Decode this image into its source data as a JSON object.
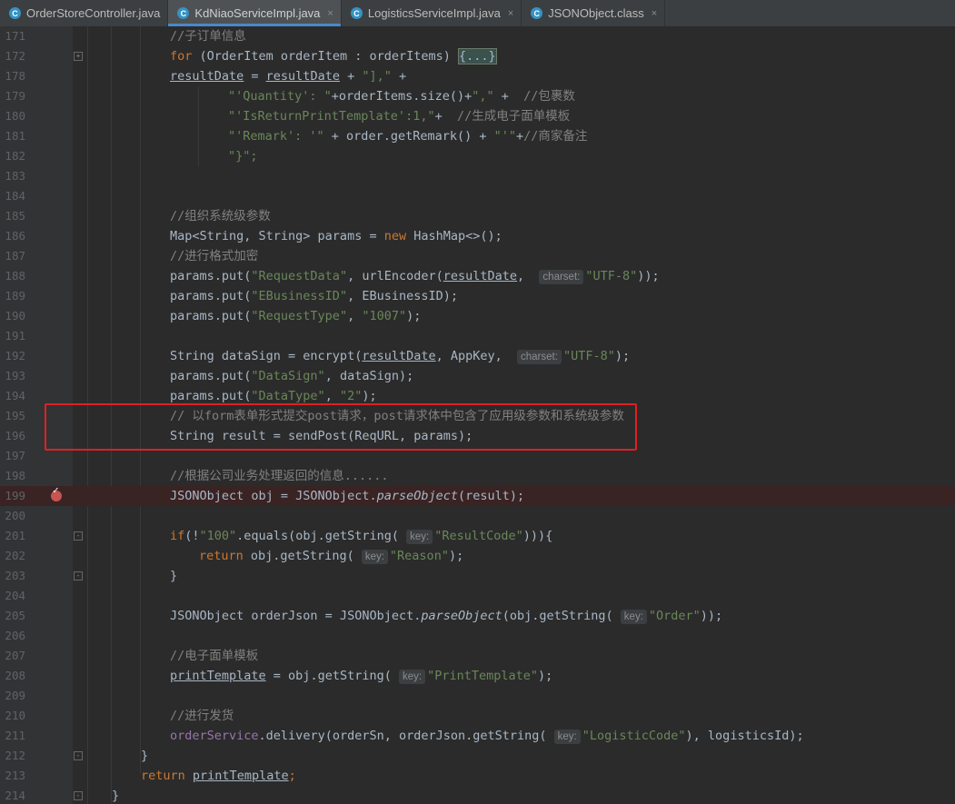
{
  "tabs": [
    {
      "label": "OrderStoreController.java",
      "active": false,
      "closable": false
    },
    {
      "label": "KdNiaoServiceImpl.java",
      "active": true,
      "closable": true
    },
    {
      "label": "LogisticsServiceImpl.java",
      "active": false,
      "closable": true
    },
    {
      "label": "JSONObject.class",
      "active": false,
      "closable": true
    }
  ],
  "tab_icon_letter": "C",
  "close_glyph": "×",
  "fold_collapsed_text": "{...}",
  "hints": {
    "charset": "charset:",
    "key": "key:"
  },
  "lines": {
    "171": "171",
    "172": "172",
    "178": "178",
    "179": "179",
    "180": "180",
    "181": "181",
    "182": "182",
    "183": "183",
    "184": "184",
    "185": "185",
    "186": "186",
    "187": "187",
    "188": "188",
    "189": "189",
    "190": "190",
    "191": "191",
    "192": "192",
    "193": "193",
    "194": "194",
    "195": "195",
    "196": "196",
    "197": "197",
    "198": "198",
    "199": "199",
    "200": "200",
    "201": "201",
    "202": "202",
    "203": "203",
    "204": "204",
    "205": "205",
    "206": "206",
    "207": "207",
    "208": "208",
    "209": "209",
    "210": "210",
    "211": "211",
    "212": "212",
    "213": "213",
    "214": "214"
  },
  "code": {
    "c171": "//子订单信息",
    "c172_a": "for",
    "c172_b": " (OrderItem orderItem : orderItems) ",
    "c178_a": "resultDate",
    "c178_b": " = ",
    "c178_c": "resultDate",
    "c178_d": " + ",
    "c178_e": "\"],\"",
    "c178_f": " +",
    "c179_a": "\"'Quantity': \"",
    "c179_b": "+orderItems.size()+",
    "c179_c": "\",\"",
    "c179_d": " +  ",
    "c179_e": "//包裹数",
    "c180_a": "\"'IsReturnPrintTemplate':1,\"",
    "c180_b": "+  ",
    "c180_c": "//生成电子面单模板",
    "c181_a": "\"'Remark': '\"",
    "c181_b": " + order.getRemark() + ",
    "c181_c": "\"'\"",
    "c181_d": "+",
    "c181_e": "//商家备注",
    "c182": "\"}\";",
    "c185": "//组织系统级参数",
    "c186_a": "Map<String, String> params = ",
    "c186_b": "new",
    "c186_c": " HashMap<>();",
    "c187": "//进行格式加密",
    "c188_a": "params.put(",
    "c188_b": "\"RequestData\"",
    "c188_c": ", urlEncoder(",
    "c188_d": "resultDate",
    "c188_e": ",  ",
    "c188_g": "\"UTF-8\"",
    "c188_h": "));",
    "c189_a": "params.put(",
    "c189_b": "\"EBusinessID\"",
    "c189_c": ", EBusinessID);",
    "c190_a": "params.put(",
    "c190_b": "\"RequestType\"",
    "c190_c": ", ",
    "c190_d": "\"1007\"",
    "c190_e": ");",
    "c192_a": "String dataSign = encrypt(",
    "c192_b": "resultDate",
    "c192_c": ", AppKey,  ",
    "c192_e": "\"UTF-8\"",
    "c192_f": ");",
    "c193_a": "params.put(",
    "c193_b": "\"DataSign\"",
    "c193_c": ", dataSign);",
    "c194_a": "params.put(",
    "c194_b": "\"DataType\"",
    "c194_c": ", ",
    "c194_d": "\"2\"",
    "c194_e": ");",
    "c195": "// 以form表单形式提交post请求，post请求体中包含了应用级参数和系统级参数",
    "c196_a": "String result = sendPost(ReqURL, params);",
    "c198": "//根据公司业务处理返回的信息......",
    "c199_a": "JSONObject obj = JSONObject.",
    "c199_b": "parseObject",
    "c199_c": "(result);",
    "c201_a": "if",
    "c201_b": "(!",
    "c201_c": "\"100\"",
    "c201_d": ".equals(obj.getString( ",
    "c201_f": "\"ResultCode\"",
    "c201_g": "))){",
    "c202_a": "return",
    "c202_b": " obj.getString( ",
    "c202_d": "\"Reason\"",
    "c202_e": ");",
    "c203": "}",
    "c205_a": "JSONObject orderJson = JSONObject.",
    "c205_b": "parseObject",
    "c205_c": "(obj.getString( ",
    "c205_e": "\"Order\"",
    "c205_f": "));",
    "c207": "//电子面单模板",
    "c208_a": "printTemplate",
    "c208_b": " = obj.getString( ",
    "c208_d": "\"PrintTemplate\"",
    "c208_e": ");",
    "c210": "//进行发货",
    "c211_a": "orderService",
    "c211_b": ".delivery(orderSn, orderJson.getString( ",
    "c211_d": "\"LogisticCode\"",
    "c211_e": "), logisticsId);",
    "c212": "}",
    "c213_a": "return",
    "c213_b": " ",
    "c213_c": "printTemplate",
    "c213_d": ";",
    "c214": "}"
  },
  "colors": {
    "keyword": "#cc7832",
    "string": "#6a8759",
    "comment": "#808080",
    "number": "#6897bb",
    "field": "#9876aa",
    "highlight_box": "#e02020",
    "breakpoint": "#c75450"
  }
}
